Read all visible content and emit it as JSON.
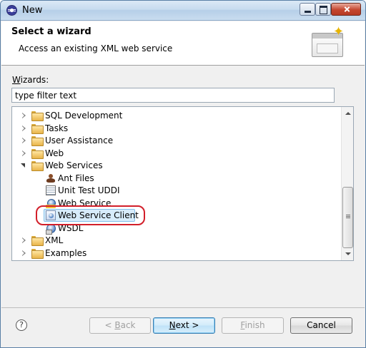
{
  "window": {
    "title": "New",
    "icon": "eclipse-app-icon"
  },
  "header": {
    "title": "Select a wizard",
    "description": "Access an existing XML web service",
    "banner_icon": "wizard-banner-icon"
  },
  "wizards": {
    "label": "Wizards:",
    "label_mnemonic": "W",
    "label_rest": "izards:",
    "filter_value": "type filter text"
  },
  "tree": {
    "items": [
      {
        "label": "SQL Development",
        "type": "folder",
        "state": "collapsed",
        "level": 0
      },
      {
        "label": "Tasks",
        "type": "folder",
        "state": "collapsed",
        "level": 0
      },
      {
        "label": "User Assistance",
        "type": "folder",
        "state": "collapsed",
        "level": 0
      },
      {
        "label": "Web",
        "type": "folder",
        "state": "collapsed",
        "level": 0
      },
      {
        "label": "Web Services",
        "type": "folder",
        "state": "expanded",
        "level": 0
      },
      {
        "label": "Ant Files",
        "type": "item",
        "icon": "ant-icon",
        "level": 1
      },
      {
        "label": "Unit Test UDDI",
        "type": "item",
        "icon": "uddi-icon",
        "level": 1
      },
      {
        "label": "Web Service",
        "type": "item",
        "icon": "web-service-icon",
        "level": 1
      },
      {
        "label": "Web Service Client",
        "type": "item",
        "icon": "web-service-client-icon",
        "level": 1,
        "selected": true
      },
      {
        "label": "WSDL",
        "type": "item",
        "icon": "wsdl-icon",
        "level": 1
      },
      {
        "label": "XML",
        "type": "folder",
        "state": "collapsed",
        "level": 0
      },
      {
        "label": "Examples",
        "type": "folder",
        "state": "collapsed",
        "level": 0
      }
    ]
  },
  "buttons": {
    "back": {
      "label": "< Back",
      "pre": "< ",
      "mnemonic": "B",
      "rest": "ack",
      "enabled": false
    },
    "next": {
      "label": "Next >",
      "mnemonic": "N",
      "rest": "ext >",
      "enabled": true
    },
    "finish": {
      "label": "Finish",
      "mnemonic": "F",
      "rest": "inish",
      "enabled": false
    },
    "cancel": {
      "label": "Cancel",
      "enabled": true
    }
  },
  "colors": {
    "selection": "#d7ecfb",
    "annotation_ring": "#d21f2a",
    "default_button": "#3c7fb1"
  }
}
